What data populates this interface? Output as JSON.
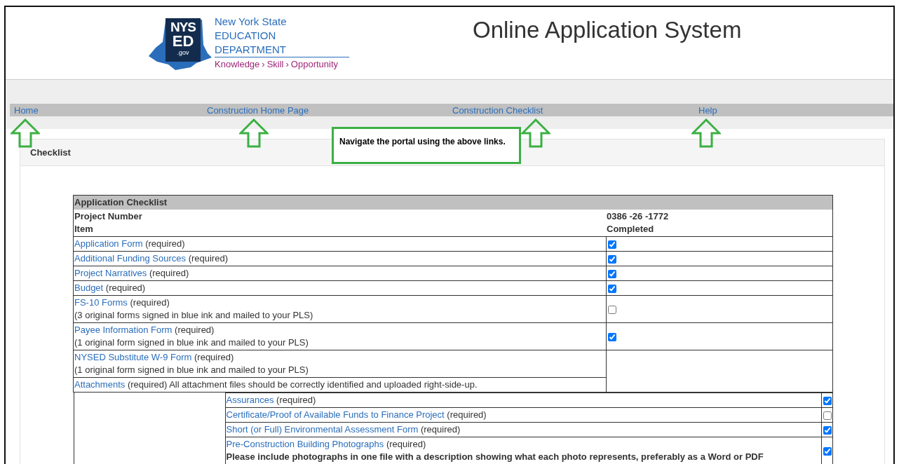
{
  "header": {
    "logo": {
      "mark_top": "NYS",
      "mark_bottom": "ED",
      "mark_domain": ".gov",
      "name_line1": "New York State",
      "name_line2": "EDUCATION DEPARTMENT",
      "tagline": [
        "Knowledge",
        "Skill",
        "Opportunity"
      ],
      "separator": "›"
    },
    "title": "Online Application System"
  },
  "nav": {
    "links": [
      {
        "label": "Home"
      },
      {
        "label": "Construction Home Page"
      },
      {
        "label": "Construction Checklist"
      },
      {
        "label": "Help"
      }
    ],
    "callout": "Navigate the portal using the above links."
  },
  "panel": {
    "title": "Checklist"
  },
  "table": {
    "title": "Application Checklist",
    "project_number_label": "Project Number",
    "project_number": "0386 -26 -1772",
    "item_label": "Item",
    "completed_label": "Completed",
    "items": [
      {
        "kind": "check",
        "link": "Application Form",
        "suffix": "(required)",
        "checked": true
      },
      {
        "kind": "check",
        "link": "Additional Funding Sources",
        "suffix": "(required)",
        "checked": true
      },
      {
        "kind": "check",
        "link": "Project Narratives",
        "suffix": "(required)",
        "checked": true
      },
      {
        "kind": "check",
        "link": "Budget",
        "suffix": "(required)",
        "checked": true
      },
      {
        "kind": "check",
        "link": "FS-10 Forms",
        "suffix": "(required)",
        "note": "(3 original forms signed in blue ink and mailed to your PLS)",
        "checked": false
      },
      {
        "kind": "check",
        "link": "Payee Information Form",
        "suffix": "(required)",
        "note": "(1 original form signed in blue ink and mailed to your PLS)",
        "checked": true
      },
      {
        "kind": "plain",
        "link": "NYSED Substitute W-9 Form",
        "suffix": "(required)",
        "note": "(1 original form signed in blue ink and mailed to your PLS)"
      },
      {
        "kind": "plain",
        "link": "Attachments",
        "suffix": "(required) All attachment files should be correctly identified and uploaded right-side-up."
      }
    ],
    "attachments": [
      {
        "link": "Assurances",
        "suffix": "(required)",
        "checked": true
      },
      {
        "link": "Certificate/Proof of Available Funds to Finance Project",
        "suffix": "(required)",
        "checked": false
      },
      {
        "link": "Short (or Full) Environmental Assessment Form",
        "suffix": "(required)",
        "checked": true
      },
      {
        "link": "Pre-Construction Building Photographs",
        "suffix": "(required)",
        "note": "Please include photographs in one file with a description showing what each photo represents, preferably as a Word or PDF",
        "checked": true
      }
    ]
  }
}
